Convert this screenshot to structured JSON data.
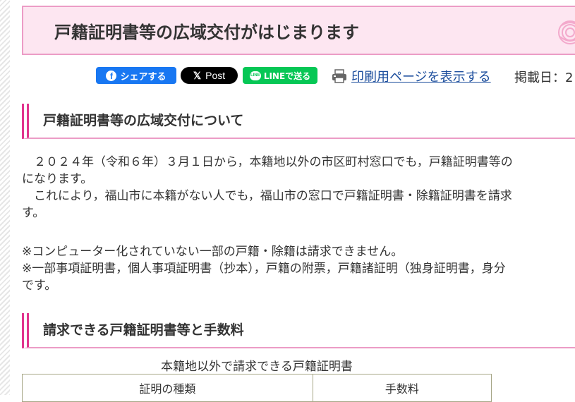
{
  "header": {
    "title": "戸籍証明書等の広域交付がはじまります",
    "icon": "rose-icon"
  },
  "share": {
    "facebook_label": "シェアする",
    "facebook_icon_glyph": "f",
    "x_label": "Post",
    "x_icon_glyph": "𝕏",
    "line_label": "LINEで送る",
    "line_icon_glyph": "LINE",
    "print_label": "印刷用ページを表示する",
    "posted_date": "掲載日：2"
  },
  "sections": [
    {
      "heading": "戸籍証明書等の広域交付について"
    },
    {
      "heading": "請求できる戸籍証明書等と手数料"
    }
  ],
  "content": {
    "para1_line1": "　２０２４年（令和６年）３月１日から，本籍地以外の市区町村窓口でも，戸籍証明書等の",
    "para1_line2": "になります。",
    "para2_line1": "　これにより，福山市に本籍がない人でも，福山市の窓口で戸籍証明書・除籍証明書を請求",
    "para2_line2": "す。",
    "note1": "※コンピューター化されていない一部の戸籍・除籍は請求できません。",
    "note2_line1": "※一部事項証明書，個人事項証明書（抄本），戸籍の附票，戸籍諸証明（独身証明書，身分",
    "note2_line2": "です。"
  },
  "table": {
    "caption": "本籍地以外で請求できる戸籍証明書",
    "headers": [
      "証明の種類",
      "手数料"
    ]
  },
  "colors": {
    "header_bg": "#fde6f1",
    "header_border": "#ec9cc6",
    "accent_pink": "#e1348e",
    "facebook": "#1877f2",
    "x": "#000000",
    "line": "#06c755",
    "link": "#1a4c9c"
  }
}
